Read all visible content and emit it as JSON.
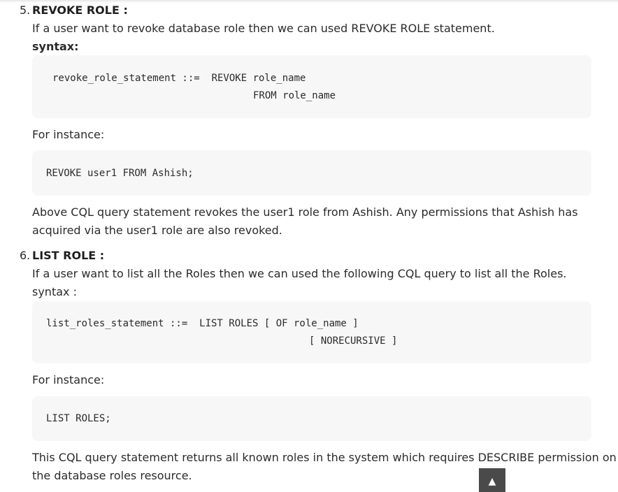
{
  "section5": {
    "number": "5.",
    "title": "REVOKE ROLE :",
    "description": "If a user want to revoke database role then we can used REVOKE ROLE statement.",
    "syntax_label": "syntax:",
    "syntax_line1": "revoke_role_statement ::=  REVOKE role_name",
    "syntax_line2": "FROM role_name",
    "instance_label": "For instance:",
    "example": "REVOKE user1 FROM Ashish;",
    "explanation_line1": "Above CQL query statement revokes the user1 role from Ashish. Any permissions that Ashish has",
    "explanation_line2": "acquired via the user1 role are also revoked."
  },
  "section6": {
    "number": "6.",
    "title": "LIST ROLE :",
    "description": "If a user want to list all the Roles then we can used the following CQL query to list all the Roles.",
    "syntax_label": "syntax :",
    "syntax_line1": "list_roles_statement ::=  LIST ROLES [ OF role_name ]",
    "syntax_line2": "[ NORECURSIVE ]",
    "instance_label": "For instance:",
    "example": "LIST ROLES;",
    "explanation_line1": "This CQL query statement returns all known roles in the system which requires DESCRIBE permission on",
    "explanation_line2": "the database roles resource."
  },
  "scroll_top_button": {
    "icon": "▲"
  }
}
